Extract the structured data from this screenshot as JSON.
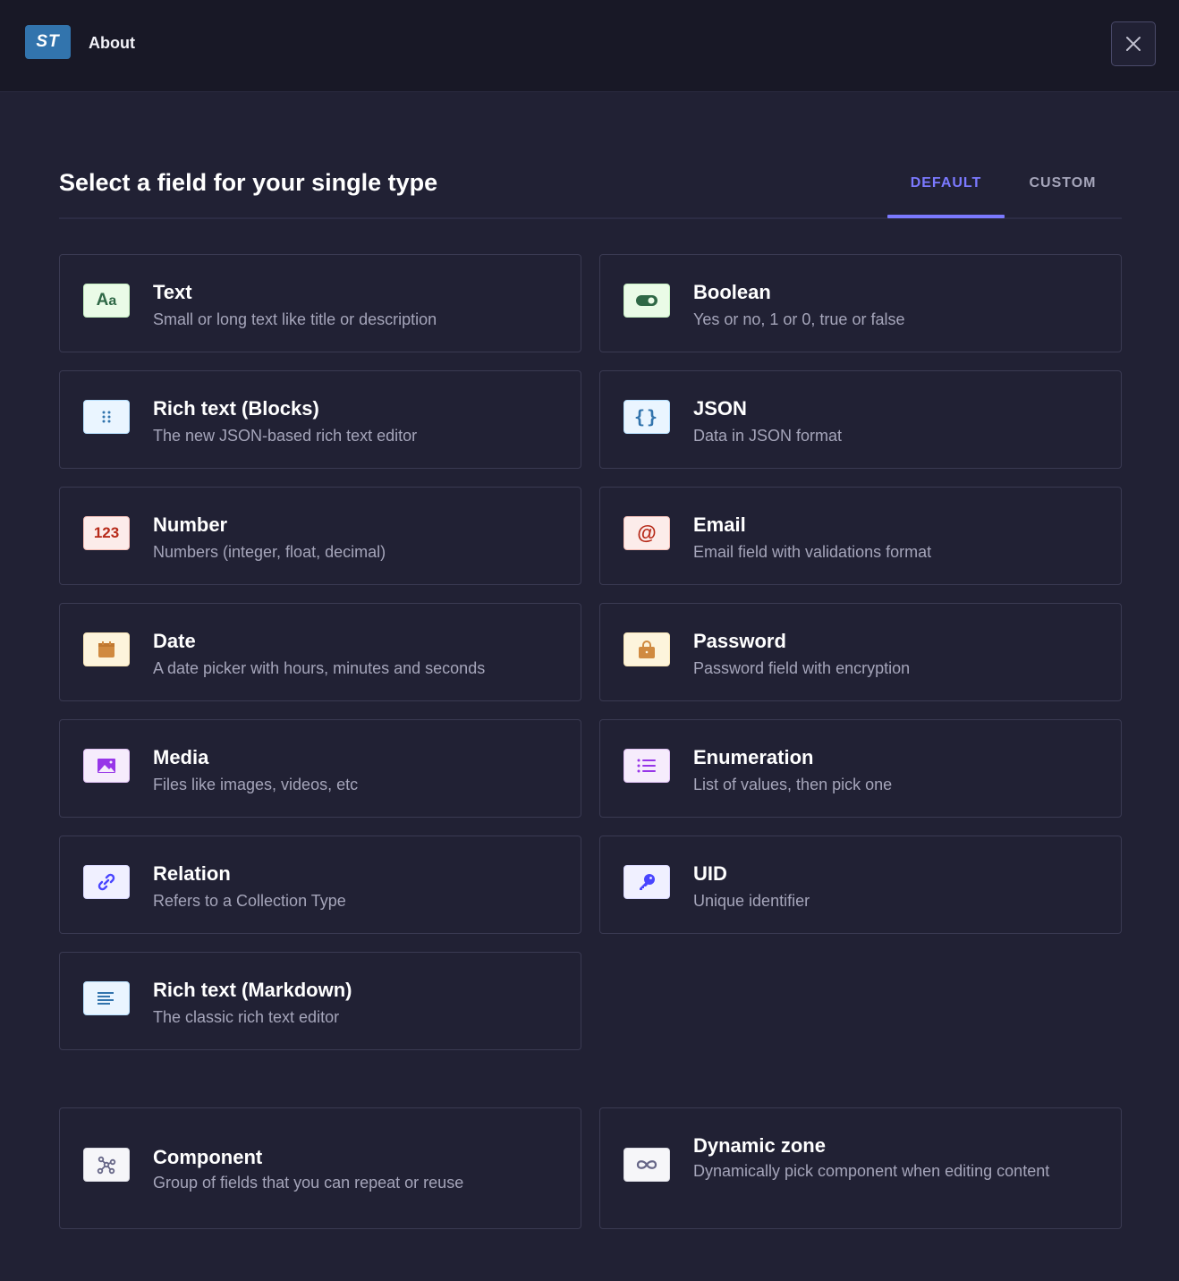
{
  "header": {
    "logo_text": "ST",
    "title": "About",
    "close_icon": "close-icon"
  },
  "main": {
    "title": "Select a field for your single type",
    "tabs": [
      {
        "label": "DEFAULT",
        "active": true
      },
      {
        "label": "CUSTOM",
        "active": false
      }
    ]
  },
  "fields": [
    {
      "title": "Text",
      "description": "Small or long text like title or description",
      "icon": "text-icon"
    },
    {
      "title": "Boolean",
      "description": "Yes or no, 1 or 0, true or false",
      "icon": "toggle-icon"
    },
    {
      "title": "Rich text (Blocks)",
      "description": "The new JSON-based rich text editor",
      "icon": "blocks-icon"
    },
    {
      "title": "JSON",
      "description": "Data in JSON format",
      "icon": "braces-icon"
    },
    {
      "title": "Number",
      "description": "Numbers (integer, float, decimal)",
      "icon": "number-icon",
      "icon_text": "123"
    },
    {
      "title": "Email",
      "description": "Email field with validations format",
      "icon": "at-sign-icon",
      "icon_text": "@"
    },
    {
      "title": "Date",
      "description": "A date picker with hours, minutes and seconds",
      "icon": "calendar-icon"
    },
    {
      "title": "Password",
      "description": "Password field with encryption",
      "icon": "lock-icon"
    },
    {
      "title": "Media",
      "description": "Files like images, videos, etc",
      "icon": "image-icon"
    },
    {
      "title": "Enumeration",
      "description": "List of values, then pick one",
      "icon": "list-icon"
    },
    {
      "title": "Relation",
      "description": "Refers to a Collection Type",
      "icon": "link-icon"
    },
    {
      "title": "UID",
      "description": "Unique identifier",
      "icon": "key-icon"
    },
    {
      "title": "Rich text (Markdown)",
      "description": "The classic rich text editor",
      "icon": "align-left-icon"
    }
  ],
  "extra_fields": [
    {
      "title": "Component",
      "description": "Group of fields that you can repeat or reuse",
      "icon": "component-icon"
    },
    {
      "title": "Dynamic zone",
      "description": "Dynamically pick component when editing content",
      "icon": "infinity-icon"
    }
  ],
  "colors": {
    "accent": "#7b79ff",
    "background": "#212134",
    "header_background": "#181826"
  }
}
